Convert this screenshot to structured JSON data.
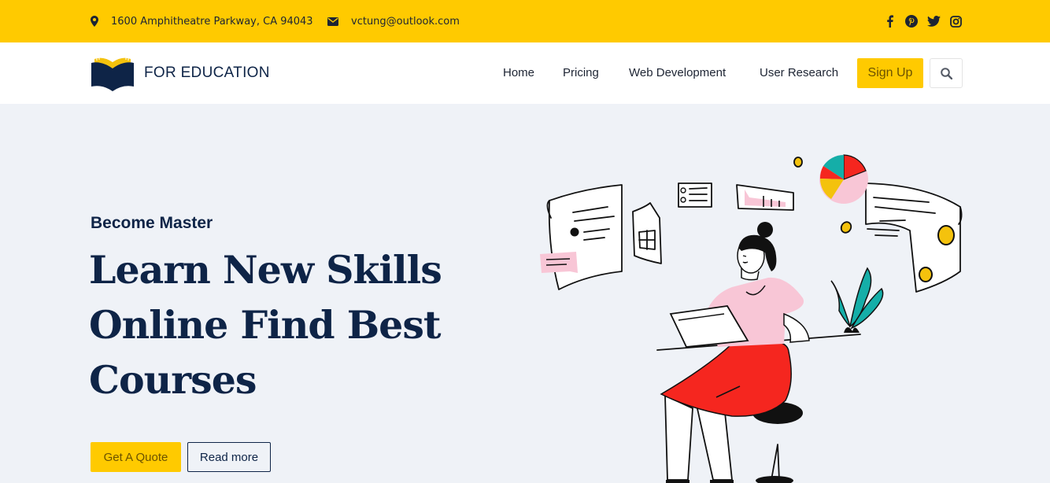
{
  "topbar": {
    "address": "1600 Amphitheatre Parkway, CA 94043",
    "email": "vctung@outlook.com",
    "socials": [
      "facebook-icon",
      "pinterest-icon",
      "twitter-icon",
      "instagram-icon"
    ]
  },
  "brand": {
    "name": "FOR EDUCATION"
  },
  "nav": {
    "items": [
      "Home",
      "Pricing",
      "Web Development",
      "User Research"
    ],
    "signup": "Sign Up"
  },
  "hero": {
    "subtitle": "Become Master",
    "title": "Learn New Skills Online Find Best Courses",
    "quote_button": "Get A Quote",
    "read_button": "Read more"
  },
  "colors": {
    "accent": "#ffca00",
    "navy": "#0e2447",
    "background": "#eff2f7"
  }
}
